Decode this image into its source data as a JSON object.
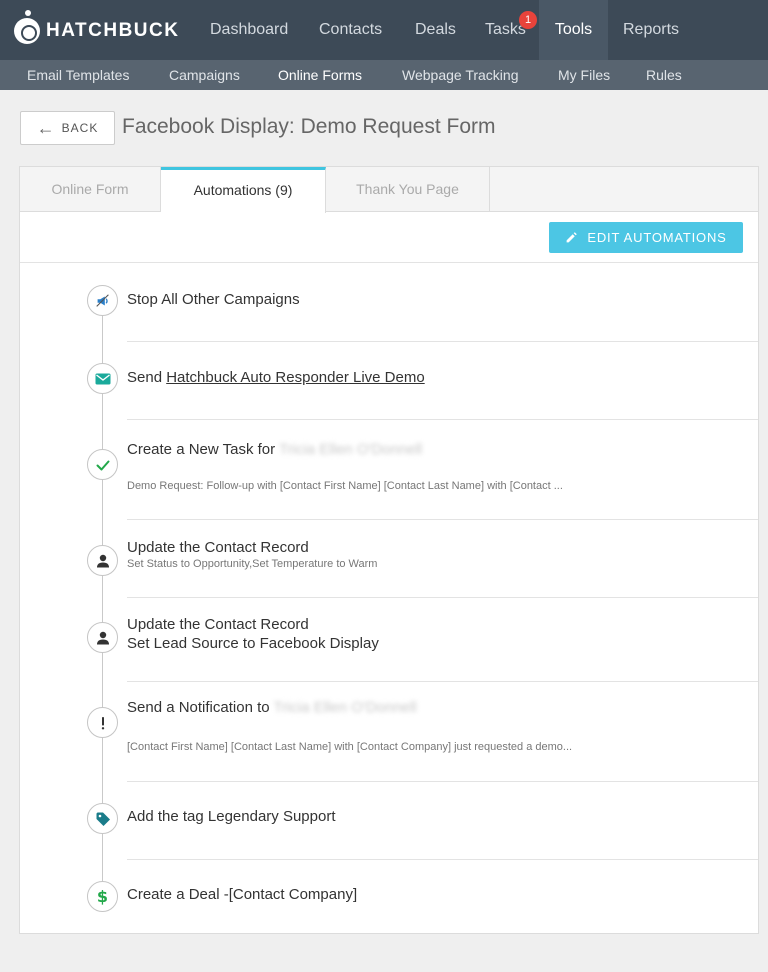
{
  "brand": {
    "name": "HATCHBUCK"
  },
  "nav": {
    "items": [
      "Dashboard",
      "Contacts",
      "Deals",
      "Tasks",
      "Tools",
      "Reports"
    ],
    "active": "Tools",
    "tasks_badge": "1"
  },
  "subnav": {
    "items": [
      "Email Templates",
      "Campaigns",
      "Online Forms",
      "Webpage Tracking",
      "My Files",
      "Rules"
    ],
    "active": "Online Forms"
  },
  "page": {
    "back_label": "BACK",
    "title": "Facebook Display: Demo Request Form"
  },
  "tabs": [
    "Online Form",
    "Automations (9)",
    "Thank You Page"
  ],
  "edit_button": "EDIT AUTOMATIONS",
  "steps": [
    {
      "icon": "megaphone-icon",
      "title": "Stop All Other Campaigns"
    },
    {
      "icon": "email-icon",
      "title_prefix": "Send ",
      "title_link": "Hatchbuck Auto Responder Live Demo"
    },
    {
      "icon": "check-icon",
      "title_prefix": "Create a New Task for ",
      "title_blurred": "Tricia Ellen O'Donnell",
      "subtitle": "Demo Request: Follow-up with [Contact First Name] [Contact Last Name] with [Contact ..."
    },
    {
      "icon": "person-icon",
      "title": "Update the Contact Record",
      "subtitle": "Set Status to Opportunity,Set Temperature to Warm"
    },
    {
      "icon": "person-icon",
      "title": "Update the Contact Record",
      "title_line2": "Set Lead Source to Facebook Display"
    },
    {
      "icon": "exclamation-icon",
      "title_prefix": "Send a Notification to ",
      "title_blurred": "Tricia Ellen O'Donnell",
      "subtitle": "[Contact First Name] [Contact Last Name] with [Contact Company] just requested a demo..."
    },
    {
      "icon": "tag-icon",
      "title": "Add the tag Legendary Support"
    },
    {
      "icon": "dollar-icon",
      "title": "Create a Deal -[Contact Company]"
    }
  ],
  "colors": {
    "topnav": "#3d4a57",
    "subnav": "#586470",
    "accent": "#4cc6e4",
    "badge": "#e8433b",
    "icon_blue": "#2a7fc9",
    "icon_teal": "#1aaa9b",
    "icon_green": "#22a84a"
  }
}
